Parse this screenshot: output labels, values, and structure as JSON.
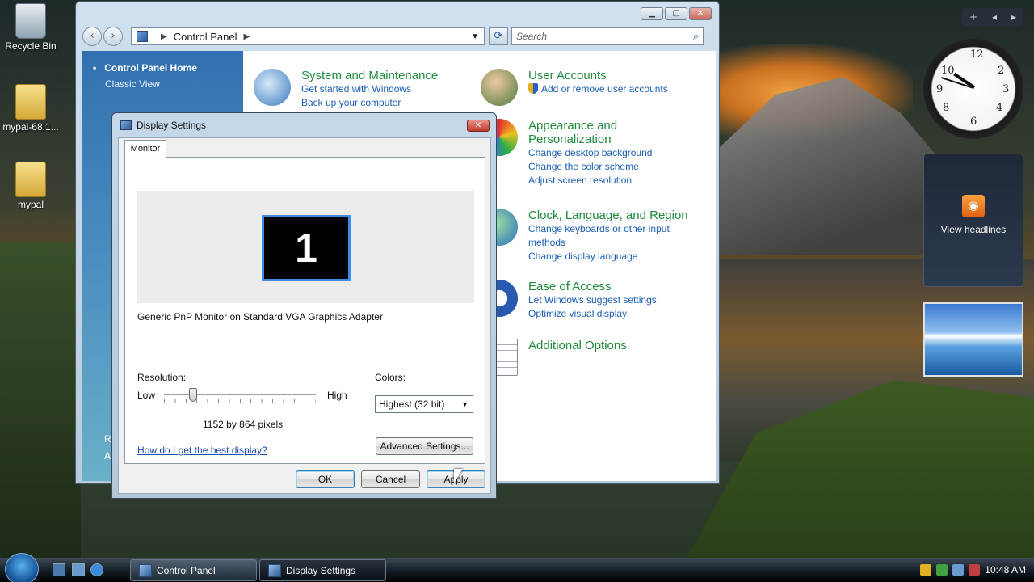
{
  "desktop": {
    "icons": [
      {
        "label": "Recycle Bin",
        "icon": "recycle-bin-icon"
      },
      {
        "label": "mypal-68.1...",
        "icon": "zip-folder-icon"
      },
      {
        "label": "mypal",
        "icon": "folder-icon"
      }
    ]
  },
  "control_panel": {
    "address_segment": "Control Panel",
    "search_placeholder": "Search",
    "sidebar": {
      "home": "Control Panel Home",
      "classic": "Classic View",
      "partial_1": "R",
      "partial_2": "A"
    },
    "categories": [
      {
        "title": "System and Maintenance",
        "links": [
          "Get started with Windows",
          "Back up your computer"
        ]
      },
      {
        "title": "User Accounts",
        "links": [
          "Add or remove user accounts"
        ]
      },
      {
        "title": "Appearance and",
        "title2": "Personalization",
        "links": [
          "Change desktop background",
          "Change the color scheme",
          "Adjust screen resolution"
        ]
      },
      {
        "title": "Clock, Language, and Region",
        "links": [
          "Change keyboards or other input",
          "methods",
          "Change display language"
        ]
      },
      {
        "title": "Ease of Access",
        "links": [
          "Let Windows suggest settings",
          "Optimize visual display"
        ]
      },
      {
        "title": "Additional Options",
        "links": []
      }
    ]
  },
  "dialog": {
    "title": "Display Settings",
    "tab": "Monitor",
    "monitor_number": "1",
    "monitor_name": "Generic PnP Monitor on Standard VGA Graphics Adapter",
    "resolution_label": "Resolution:",
    "low": "Low",
    "high": "High",
    "resolution_value": "1152 by 864 pixels",
    "resolution_level": 0.19,
    "colors_label": "Colors:",
    "colors_value": "Highest (32 bit)",
    "help_link": "How do I get the best display?",
    "advanced_button": "Advanced Settings...",
    "ok": "OK",
    "cancel": "Cancel",
    "apply": "Apply"
  },
  "gadgets": {
    "headlines": "View headlines",
    "clock_time": "10:48"
  },
  "taskbar": {
    "tasks": [
      "Control Panel",
      "Display Settings"
    ],
    "clock": "10:48 AM"
  },
  "colors": {
    "category_title": "#1e8a3a",
    "link": "#1a5fb4",
    "accent": "#3a8ee8"
  }
}
